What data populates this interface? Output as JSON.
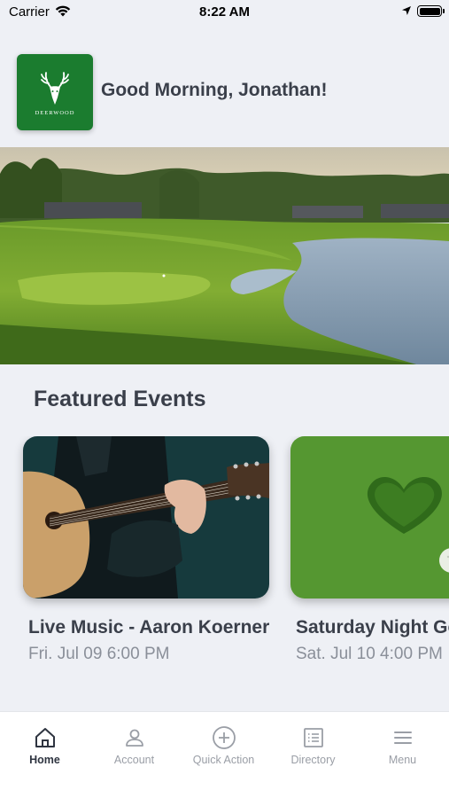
{
  "status_bar": {
    "carrier": "Carrier",
    "time": "8:22 AM"
  },
  "header": {
    "logo_text": "DEERWOOD",
    "greeting": "Good Morning, Jonathan!"
  },
  "featured": {
    "title": "Featured Events",
    "events": [
      {
        "title": "Live Music - Aaron Koerner",
        "date": "Fri. Jul 09 6:00 PM"
      },
      {
        "title": "Saturday Night Golf",
        "date": "Sat. Jul 10 4:00 PM"
      }
    ]
  },
  "tabs": [
    {
      "label": "Home",
      "icon": "home-icon",
      "active": true
    },
    {
      "label": "Account",
      "icon": "account-icon"
    },
    {
      "label": "Quick Action",
      "icon": "plus-circle-icon"
    },
    {
      "label": "Directory",
      "icon": "list-icon"
    },
    {
      "label": "Menu",
      "icon": "hamburger-icon"
    }
  ],
  "colors": {
    "brand_green": "#1b7c2f",
    "background": "#eef0f5",
    "text": "#3a3f4a",
    "muted": "#8a8f99"
  }
}
